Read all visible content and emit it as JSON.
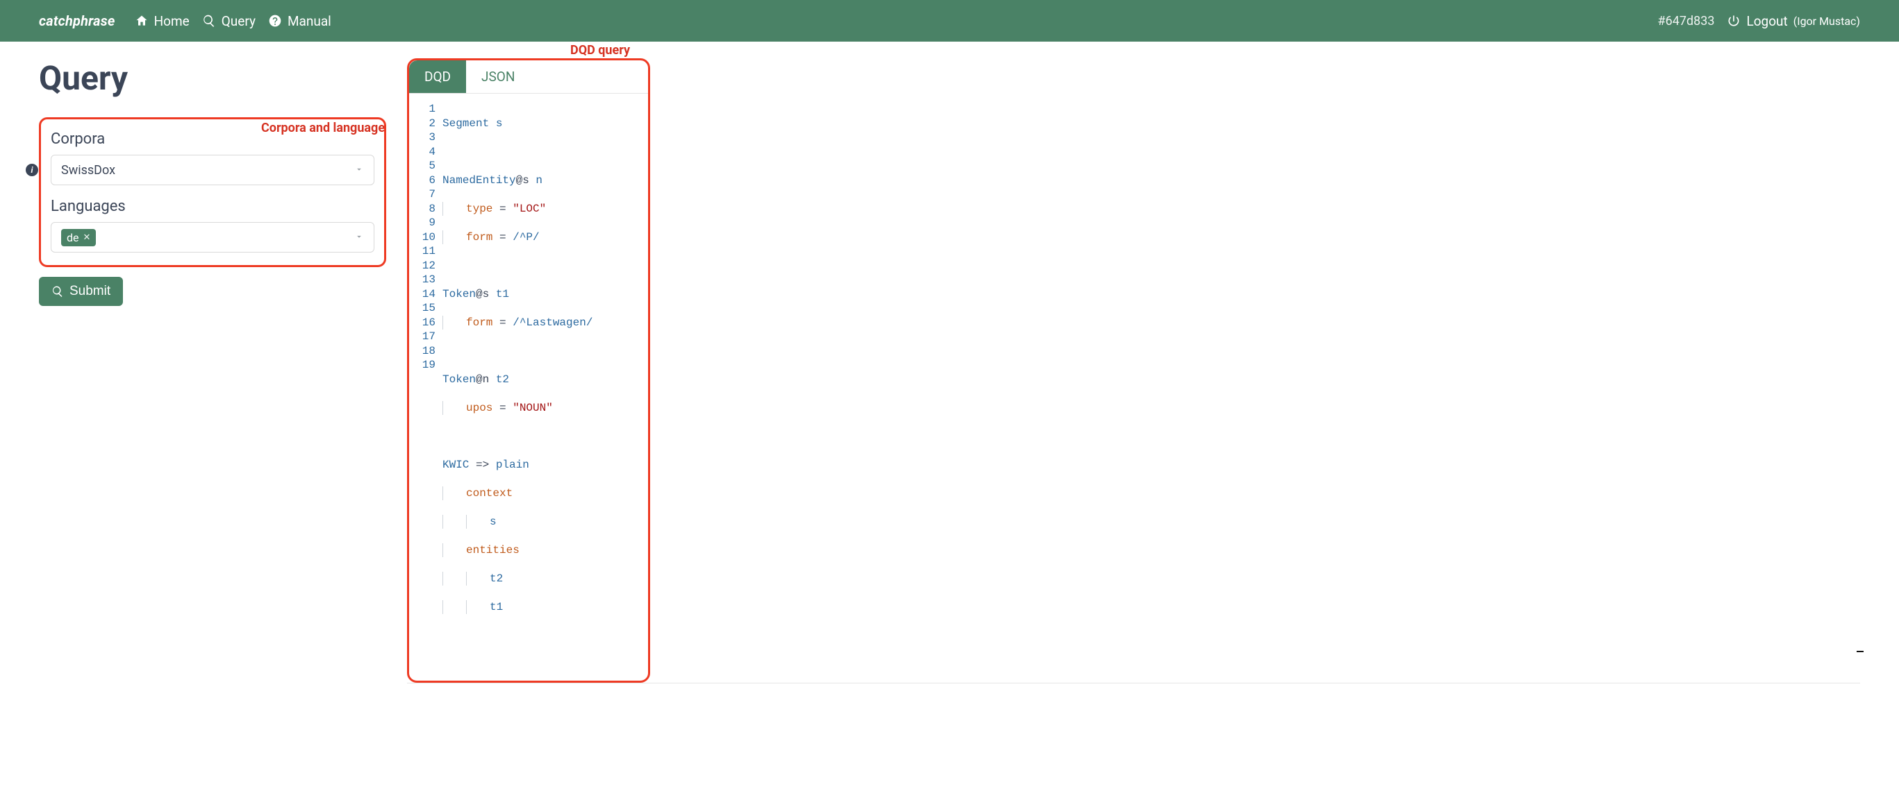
{
  "brand": "catchphrase",
  "nav": {
    "home": "Home",
    "query": "Query",
    "manual": "Manual"
  },
  "hash": "#647d833",
  "logout": {
    "label": "Logout",
    "user": "(Igor Mustac)"
  },
  "page_title": "Query",
  "annotations": {
    "left": "Corpora and language",
    "right": "DQD query"
  },
  "corpora": {
    "label": "Corpora",
    "selected": "SwissDox"
  },
  "languages": {
    "label": "Languages",
    "chip": "de"
  },
  "info_tooltip": "i",
  "submit_label": "Submit",
  "tabs": {
    "dqd": "DQD",
    "json": "JSON"
  },
  "code": {
    "l1": {
      "a": "Segment",
      "b": " s"
    },
    "l3": {
      "a": "NamedEntity",
      "b": "@s",
      "c": " n"
    },
    "l4": {
      "a": "type",
      "b": " = ",
      "c": "\"LOC\""
    },
    "l5": {
      "a": "form",
      "b": " = ",
      "c": "/^P/"
    },
    "l7": {
      "a": "Token",
      "b": "@s",
      "c": " t1"
    },
    "l8": {
      "a": "form",
      "b": " = ",
      "c": "/^Lastwagen/"
    },
    "l10": {
      "a": "Token",
      "b": "@n",
      "c": " t2"
    },
    "l11": {
      "a": "upos",
      "b": " = ",
      "c": "\"NOUN\""
    },
    "l13": {
      "a": "KWIC",
      "b": " => ",
      "c": "plain"
    },
    "l14": {
      "a": "context"
    },
    "l15": {
      "a": "s"
    },
    "l16": {
      "a": "entities"
    },
    "l17": {
      "a": "t2"
    },
    "l18": {
      "a": "t1"
    }
  }
}
